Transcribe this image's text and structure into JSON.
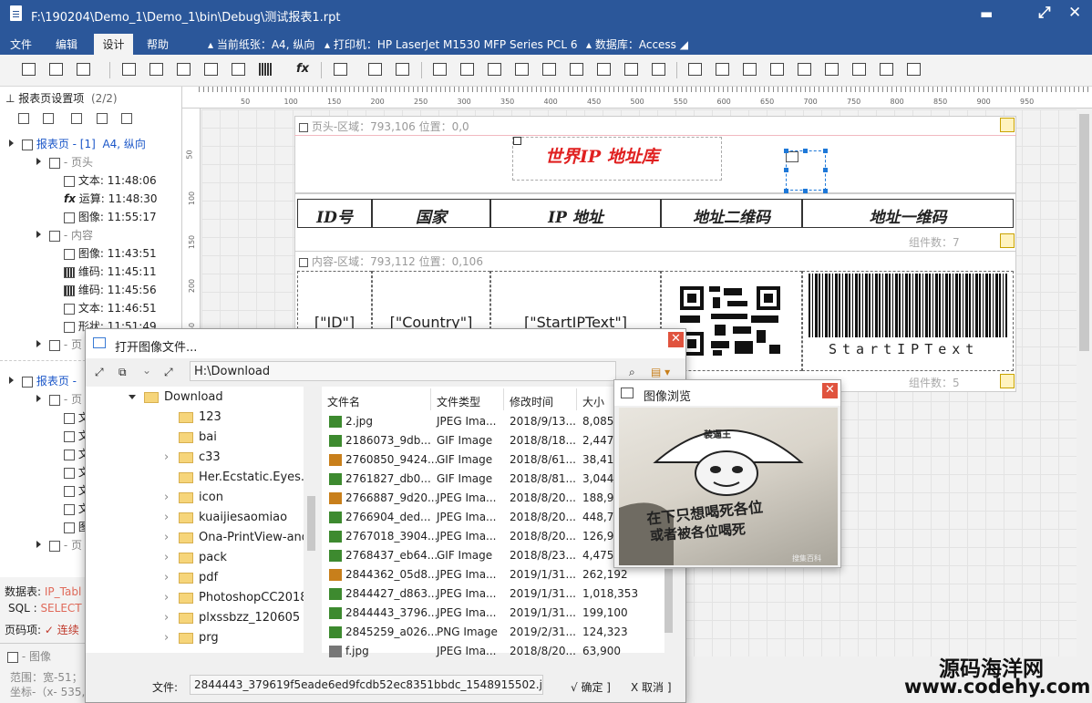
{
  "window": {
    "title": "F:\\190204\\Demo_1\\Demo_1\\bin\\Debug\\测试报表1.rpt"
  },
  "menu": {
    "items": [
      "文件",
      "编辑",
      "设计",
      "帮助"
    ],
    "paper": "当前纸张：A4, 纵向",
    "printer": "打印机：HP LaserJet M1530 MFP Series PCL 6",
    "database": "数据库：Access"
  },
  "left_panel": {
    "title": "报表页设置项",
    "count": "(2/2)",
    "page1": {
      "label": "报表页 - [1]",
      "orient": "A4, 纵向"
    },
    "header_node": "- 页头",
    "header_items": [
      {
        "type": "文本:",
        "time": "11:48:06"
      },
      {
        "type": "运算:",
        "time": "11:48:30"
      },
      {
        "type": "图像:",
        "time": "11:55:17"
      }
    ],
    "content_node": "- 内容",
    "content_items": [
      {
        "type": "图像:",
        "time": "11:43:51"
      },
      {
        "type": "维码:",
        "time": "11:45:11"
      },
      {
        "type": "维码:",
        "time": "11:45:56"
      },
      {
        "type": "文本:",
        "time": "11:46:51"
      },
      {
        "type": "形状:",
        "time": "11:51:49"
      }
    ],
    "footer_node": "- 页",
    "page2_label": "报表页 -",
    "p2_header": "- 页",
    "p2_items": [
      "文",
      "文",
      "文",
      "文",
      "文",
      "文",
      "图"
    ],
    "p2_footer": "- 页",
    "db_label": "数据表:",
    "db_value": "IP_Tabl",
    "sql_label": "SQL :",
    "sql_value": "SELECT",
    "page_label": "页码项:",
    "page_value": "✓ 连续",
    "img_label": "- 图像",
    "range": "范围：宽-51；",
    "coords": "坐标-（x- 535,"
  },
  "canvas": {
    "header_band": "页头-区域：793,106     位置：0,0",
    "title_text": "世界IP 地址库",
    "columns": [
      "ID号",
      "国家",
      "IP 地址",
      "地址二维码",
      "地址一维码"
    ],
    "header_count": "组件数：7",
    "content_band": "内容-区域：793,112     位置：0,106",
    "content_cells": [
      "[\"ID\"]",
      "[\"Country\"]",
      "[\"StartIPText\"]"
    ],
    "barcode_text": "StartIPText",
    "content_count": "组件数：5"
  },
  "ruler_labels": [
    "50",
    "100",
    "150",
    "200",
    "250",
    "300",
    "350",
    "400",
    "450",
    "500",
    "550",
    "600",
    "650",
    "700",
    "750",
    "800",
    "850",
    "900",
    "950"
  ],
  "vruler_labels": [
    "50",
    "100",
    "150",
    "200",
    "250"
  ],
  "dialog": {
    "title": "打开图像文件...",
    "path": "H:\\Download",
    "tree": [
      {
        "name": "Download",
        "expanded": true
      },
      {
        "name": "123"
      },
      {
        "name": "bai"
      },
      {
        "name": "c33",
        "arrow": true
      },
      {
        "name": "Her.Ecstatic.Eyes.20"
      },
      {
        "name": "icon",
        "arrow": true
      },
      {
        "name": "kuaijiesaomiao",
        "arrow": true
      },
      {
        "name": "Ona-PrintView-and-",
        "arrow": true
      },
      {
        "name": "pack",
        "arrow": true
      },
      {
        "name": "pdf",
        "arrow": true
      },
      {
        "name": "PhotoshopCC2018P",
        "arrow": true
      },
      {
        "name": "plxssbzz_120605",
        "arrow": true
      },
      {
        "name": "prg",
        "arrow": true
      }
    ],
    "columns": [
      "文件名",
      "文件类型",
      "修改时间",
      "大小"
    ],
    "files": [
      {
        "name": "2.jpg",
        "type": "JPEG Ima...",
        "date": "2018/9/13...",
        "size": "8,085",
        "icon": "jpg"
      },
      {
        "name": "2186073_9db...",
        "type": "GIF Image",
        "date": "2018/8/18...",
        "size": "2,447,",
        "icon": "jpg"
      },
      {
        "name": "2760850_9424...",
        "type": "GIF Image",
        "date": "2018/8/61...",
        "size": "38,419",
        "icon": "gif"
      },
      {
        "name": "2761827_db0...",
        "type": "GIF Image",
        "date": "2018/8/81...",
        "size": "3,044,",
        "icon": "jpg"
      },
      {
        "name": "2766887_9d20...",
        "type": "JPEG Ima...",
        "date": "2018/8/20...",
        "size": "188,92",
        "icon": "gif"
      },
      {
        "name": "2766904_ded...",
        "type": "JPEG Ima...",
        "date": "2018/8/20...",
        "size": "448,70",
        "icon": "jpg"
      },
      {
        "name": "2767018_3904...",
        "type": "JPEG Ima...",
        "date": "2018/8/20...",
        "size": "126,92",
        "icon": "jpg"
      },
      {
        "name": "2768437_eb64...",
        "type": "GIF Image",
        "date": "2018/8/23...",
        "size": "4,475,",
        "icon": "jpg"
      },
      {
        "name": "2844362_05d8...",
        "type": "JPEG Ima...",
        "date": "2019/1/31...",
        "size": "262,192",
        "icon": "gif"
      },
      {
        "name": "2844427_d863...",
        "type": "JPEG Ima...",
        "date": "2019/1/31...",
        "size": "1,018,353",
        "icon": "jpg"
      },
      {
        "name": "2844443_3796...",
        "type": "JPEG Ima...",
        "date": "2019/1/31...",
        "size": "199,100",
        "icon": "jpg"
      },
      {
        "name": "2845259_a026...",
        "type": "PNG Image",
        "date": "2019/2/31...",
        "size": "124,323",
        "icon": "jpg"
      },
      {
        "name": "f.jpg",
        "type": "JPEG Ima...",
        "date": "2018/8/20...",
        "size": "63,900",
        "icon": "png"
      }
    ],
    "file_label": "文件:",
    "file_value": "2844443_379619f5eade6ed9fcdb52ec8351bbdc_1548915502.jpg",
    "ok": "√ 确定 ]",
    "cancel": "X 取消 ]"
  },
  "preview": {
    "title": "图像浏览",
    "hat_text": "装逼王",
    "line1": "在下只想喝死各位",
    "line2": "或者被各位喝死",
    "wm": "搜集百科"
  },
  "watermark": {
    "line1": "源码海洋网",
    "line2": "www.codehy.com"
  }
}
